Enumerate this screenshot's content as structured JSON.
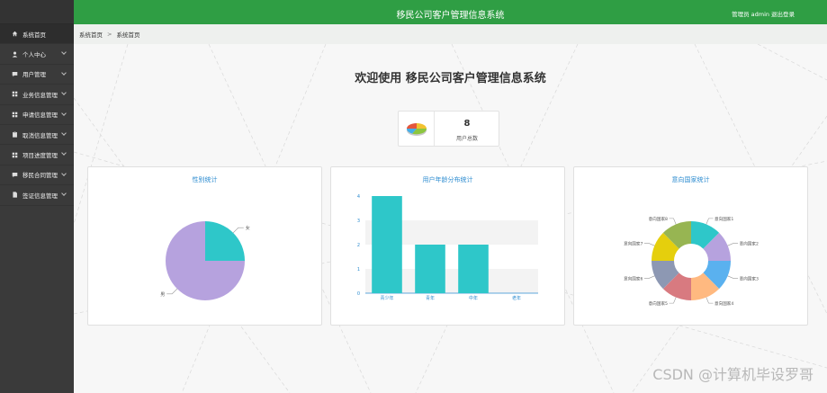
{
  "sidebar": {
    "items": [
      {
        "label": "系统首页",
        "icon": "home-icon"
      },
      {
        "label": "个人中心",
        "icon": "user-icon"
      },
      {
        "label": "用户管理",
        "icon": "chat-icon"
      },
      {
        "label": "业务信息管理",
        "icon": "grid-icon"
      },
      {
        "label": "申请信息管理",
        "icon": "grid-icon"
      },
      {
        "label": "取消信息管理",
        "icon": "clipboard-icon"
      },
      {
        "label": "项目进度管理",
        "icon": "grid-icon"
      },
      {
        "label": "移民合同管理",
        "icon": "chat-icon"
      },
      {
        "label": "签证信息管理",
        "icon": "file-icon"
      }
    ]
  },
  "header": {
    "title": "移民公司客户管理信息系统",
    "user": "管理员 admin",
    "logout": "退出登录",
    "color": "#2f9e44"
  },
  "breadcrumb": {
    "home": "系统首页",
    "current": "系统首页"
  },
  "main": {
    "welcome": "欢迎使用 移民公司客户管理信息系统",
    "stat": {
      "value": "8",
      "label": "用户总数"
    }
  },
  "charts": {
    "gender_title": "性别统计",
    "age_title": "用户年龄分布统计",
    "country_title": "意向国家统计"
  },
  "chart_data": [
    {
      "type": "pie",
      "title": "性别统计",
      "labels": [
        "女",
        "男"
      ],
      "values": [
        2,
        6
      ],
      "colors": [
        "#2ec7c9",
        "#b6a2de"
      ]
    },
    {
      "type": "bar",
      "title": "用户年龄分布统计",
      "categories": [
        "青少年",
        "青年",
        "中年",
        "老年"
      ],
      "values": [
        4,
        2,
        2,
        0
      ],
      "ylim": [
        0,
        4
      ],
      "yticks": [
        0,
        1,
        2,
        3,
        4
      ],
      "color": "#2ec7c9"
    },
    {
      "type": "pie",
      "title": "意向国家统计",
      "labels": [
        "意向国家1",
        "意向国家2",
        "意向国家3",
        "意向国家4",
        "意向国家5",
        "意向国家6",
        "意向国家7",
        "意向国家8"
      ],
      "values": [
        1,
        1,
        1,
        1,
        1,
        1,
        1,
        1
      ],
      "colors": [
        "#2ec7c9",
        "#b6a2de",
        "#5ab1ef",
        "#ffb980",
        "#d87a80",
        "#8d98b3",
        "#e5cf0d",
        "#97b552"
      ]
    }
  ],
  "watermark": "CSDN @计算机毕设罗哥"
}
